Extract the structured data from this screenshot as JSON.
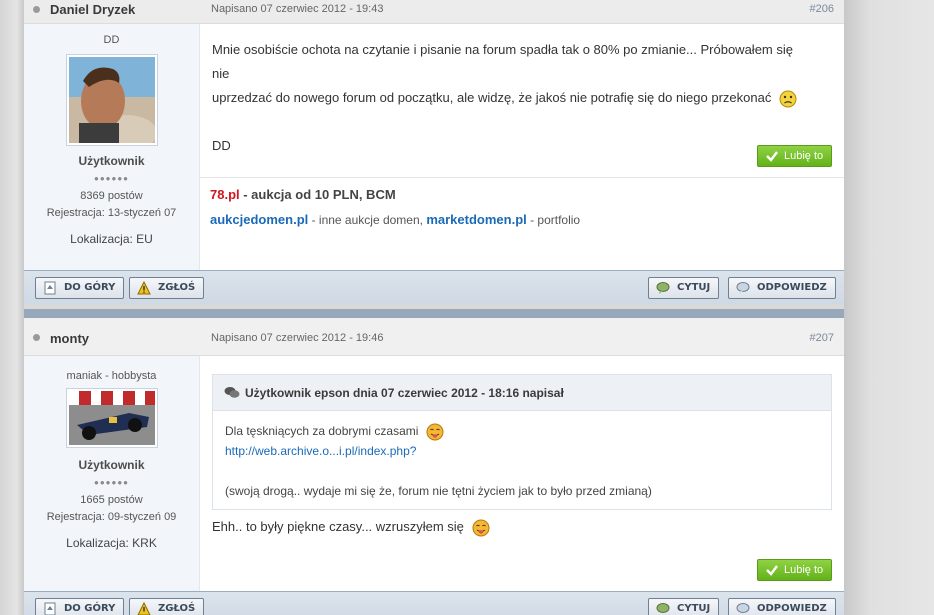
{
  "posts": [
    {
      "author": "Daniel Dryzek",
      "posted": "Napisano 07 czerwiec 2012 - 19:43",
      "number": "#206",
      "user_title": "DD",
      "group": "Użytkownik",
      "pips": "●●●●●●",
      "post_count": "8369 postów",
      "joined": "Rejestracja: 13-styczeń 07",
      "location": "Lokalizacja: EU",
      "message_line1": "Mnie osobiście ochota na czytanie i pisanie na forum spadła tak o 80% po zmianie... Próbowałem się nie",
      "message_line2": "uprzedzać do nowego forum od początku, ale widzę, że jakoś nie potrafię się do niego przekonać",
      "message_sign": "DD",
      "like_label": "Lubię to",
      "signature": {
        "domain_78": "78.pl",
        "auction_text": " - aukcja od 10 PLN, BCM",
        "link1": "aukcjedomen.pl",
        "text1": " - inne aukcje domen, ",
        "link2": "marketdomen.pl",
        "text2": " - portfolio"
      }
    },
    {
      "author": "monty",
      "posted": "Napisano 07 czerwiec 2012 - 19:46",
      "number": "#207",
      "user_title": "maniak - hobbysta",
      "group": "Użytkownik",
      "pips": "●●●●●●",
      "post_count": "1665 postów",
      "joined": "Rejestracja: 09-styczeń 09",
      "location": "Lokalizacja: KRK",
      "quote_header": "Użytkownik epson dnia 07 czerwiec 2012 - 18:16 napisał",
      "quote_line1": "Dla tęskniących za dobrymi czasami",
      "quote_link": "http://web.archive.o...i.pl/index.php?",
      "quote_line3": "(swoją drogą.. wydaje mi się że, forum nie tętni życiem jak to było przed zmianą)",
      "message": "Ehh.. to były piękne czasy... wzruszyłem się",
      "like_label": "Lubię to"
    }
  ],
  "footer": {
    "top_label": "DO GÓRY",
    "report_label": "ZGŁOŚ",
    "quote_label": "CYTUJ",
    "reply_label": "ODPOWIEDZ"
  },
  "icons": {
    "avatar1": "profile-photo-man",
    "avatar2": "profile-photo-racecar",
    "smiley_sad": "confused-smiley-icon",
    "smiley_tongue": "tongue-smiley-icon"
  }
}
